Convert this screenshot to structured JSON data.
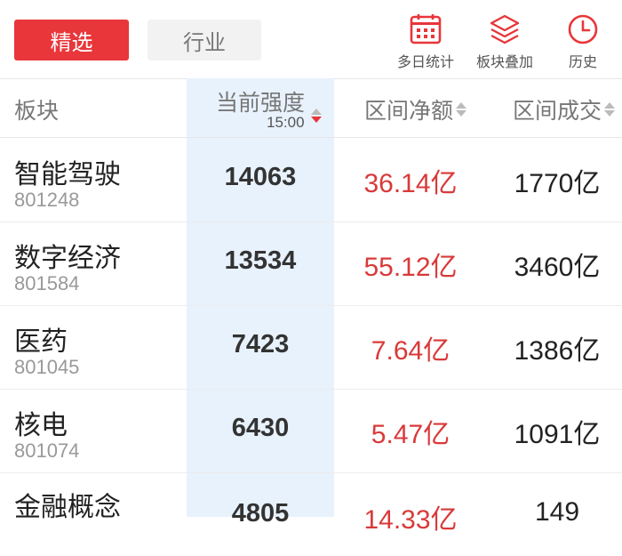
{
  "tabs": {
    "active": "精选",
    "inactive": "行业"
  },
  "tools": [
    {
      "label": "多日统计",
      "icon": "calendar-grid-icon"
    },
    {
      "label": "板块叠加",
      "icon": "layers-icon"
    },
    {
      "label": "历史",
      "icon": "clock-icon"
    }
  ],
  "header": {
    "sector": "板块",
    "strength": "当前强度",
    "strength_time": "15:00",
    "net": "区间净额",
    "turnover": "区间成交"
  },
  "rows": [
    {
      "name": "智能驾驶",
      "code": "801248",
      "strength": "14063",
      "net": "36.14亿",
      "turnover": "1770亿"
    },
    {
      "name": "数字经济",
      "code": "801584",
      "strength": "13534",
      "net": "55.12亿",
      "turnover": "3460亿"
    },
    {
      "name": "医药",
      "code": "801045",
      "strength": "7423",
      "net": "7.64亿",
      "turnover": "1386亿"
    },
    {
      "name": "核电",
      "code": "801074",
      "strength": "6430",
      "net": "5.47亿",
      "turnover": "1091亿"
    },
    {
      "name": "金融概念",
      "code": "",
      "strength": "4805",
      "net": "14.33亿",
      "turnover": "149"
    }
  ],
  "colors": {
    "accent": "#e8363a",
    "highlight_column": "#e8f2fd",
    "positive": "#d93a3a"
  }
}
